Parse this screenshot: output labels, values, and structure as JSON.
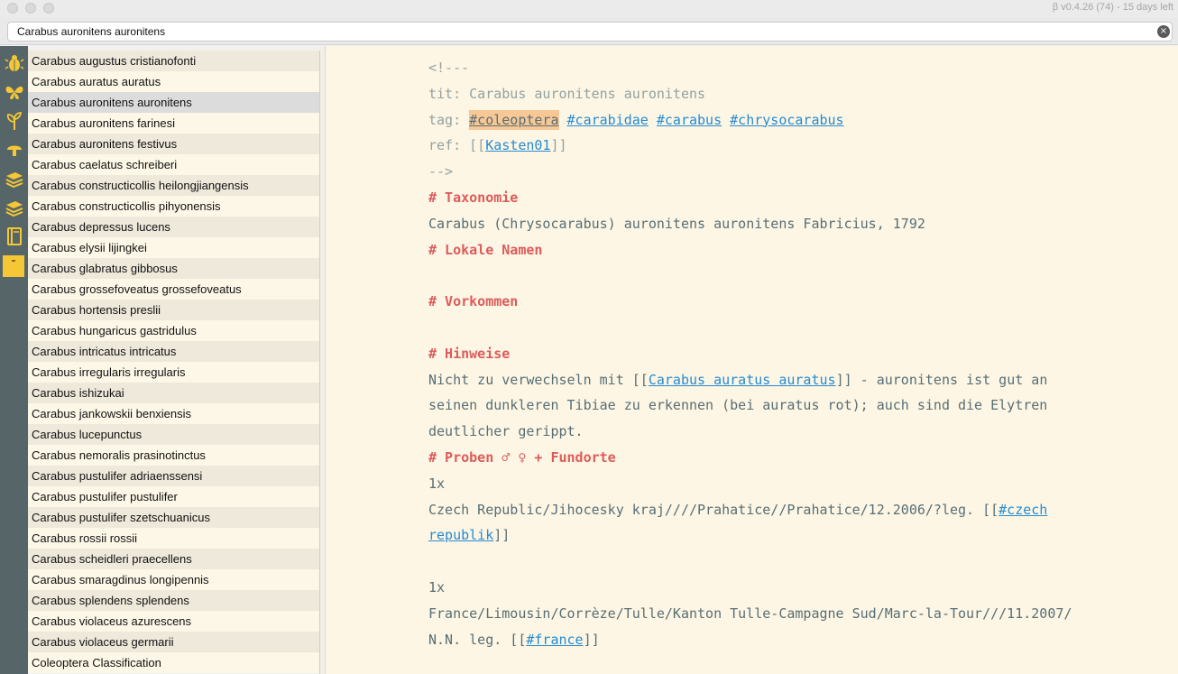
{
  "titlebar": {
    "version_text": "β v0.4.26 (74) - 15 days left"
  },
  "search": {
    "value": "Carabus auronitens auronitens",
    "clear_glyph": "×"
  },
  "rail": {
    "icons": [
      "beetle-icon",
      "butterfly-icon",
      "plant-icon",
      "mushroom-icon",
      "books-icon",
      "books-stack-icon",
      "notebook-icon",
      "folder-icon"
    ],
    "accent_color": "#f5c736"
  },
  "notes": [
    "Carabus augustus cristianofonti",
    "Carabus auratus auratus",
    "Carabus auronitens auronitens",
    "Carabus auronitens farinesi",
    "Carabus auronitens festivus",
    "Carabus caelatus schreiberi",
    "Carabus constructicollis heilongjiangensis",
    "Carabus constructicollis pihyonensis",
    "Carabus depressus lucens",
    "Carabus elysii lijingkei",
    "Carabus glabratus gibbosus",
    "Carabus grossefoveatus grossefoveatus",
    "Carabus hortensis preslii",
    "Carabus hungaricus gastridulus",
    "Carabus intricatus intricatus",
    "Carabus irregularis irregularis",
    "Carabus ishizukai",
    "Carabus jankowskii benxiensis",
    "Carabus lucepunctus",
    "Carabus nemoralis prasinotinctus",
    "Carabus pustulifer adriaenssensi",
    "Carabus pustulifer pustulifer",
    "Carabus pustulifer szetschuanicus",
    "Carabus rossii rossii",
    "Carabus scheidleri praecellens",
    "Carabus smaragdinus longipennis",
    "Carabus splendens splendens",
    "Carabus violaceus azurescens",
    "Carabus violaceus germarii",
    "Coleoptera Classification"
  ],
  "selected_note_index": 2,
  "editor": {
    "comment_open": "<!---",
    "tit_label": "tit: ",
    "tit_value": "Carabus auronitens auronitens",
    "tag_label": "tag: ",
    "tags": [
      "#coleoptera",
      "#carabidae",
      "#carabus",
      "#chrysocarabus"
    ],
    "ref_label": "ref: ",
    "ref_open": "[[",
    "ref_link": "Kasten01",
    "ref_close": "]]",
    "comment_close": "-->",
    "h_taxonomie": "# Taxonomie",
    "taxonomie_text": "Carabus (Chrysocarabus) auronitens auronitens Fabricius, 1792",
    "h_lokale": "# Lokale Namen",
    "h_vorkommen": "# Vorkommen",
    "h_hinweise": "# Hinweise",
    "hinweise_1a": "Nicht zu verwechseln mit [[",
    "hinweise_link": "Carabus auratus auratus",
    "hinweise_1b": "]] - auronitens ist gut an",
    "hinweise_2": "seinen dunkleren Tibiae zu erkennen (bei auratus rot); auch sind die Elytren",
    "hinweise_3": "deutlicher gerippt.",
    "h_proben": "# Proben ♂ ♀ + Fundorte",
    "count_1": "1x",
    "fund_1a": "Czech Republic/Jihocesky kraj////Prahatice//Prahatice/12.2006/?leg. [[",
    "fund_1_link_a": "#czech",
    "fund_1_link_b": "republik",
    "fund_1_close": "]]",
    "count_2": "1x",
    "fund_2a": "France/Limousin/Corrèze/Tulle/Kanton Tulle-Campagne Sud/Marc-la-Tour///11.2007/",
    "fund_2b": "N.N. leg. [[",
    "fund_2_link": "#france",
    "fund_2_close": "]]"
  },
  "colors": {
    "heading": "#dc5c5c",
    "link": "#268bd2",
    "editor_bg": "#fdf6e4",
    "tag_highlight": "#f7c896"
  }
}
